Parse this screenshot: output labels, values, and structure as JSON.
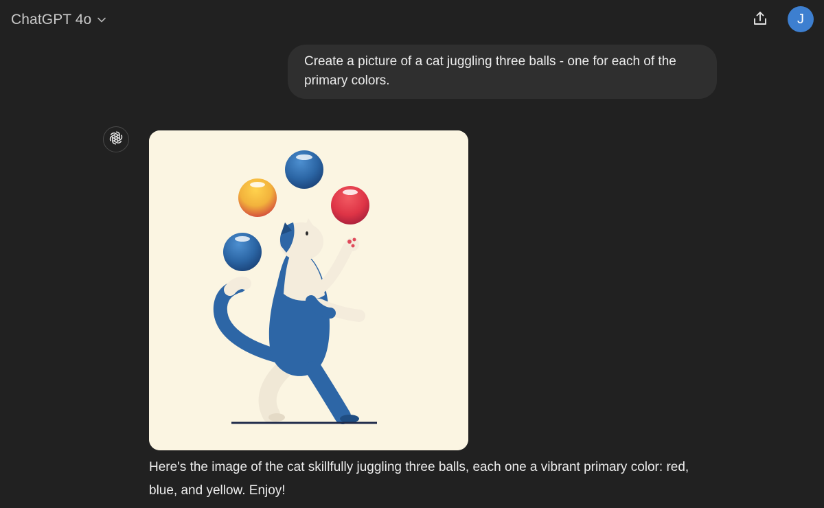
{
  "header": {
    "model_name": "ChatGPT 4o",
    "chevron_icon": "chevron-down-icon",
    "share_icon": "share-upload-icon",
    "avatar_initial": "J",
    "avatar_color": "#3d7fd0"
  },
  "conversation": {
    "user_message": "Create a picture of a cat juggling three balls - one for each of the primary colors.",
    "assistant_icon": "openai-logo-icon",
    "assistant_image": {
      "subject": "cat-juggling-illustration",
      "ball_colors": [
        "#2f6aa8",
        "#f0b43a",
        "#e03a48",
        "#2f6aa8"
      ],
      "background_color": "#fbf5e2"
    },
    "assistant_message": "Here's the image of the cat skillfully juggling three balls, each one a vibrant primary color: red, blue, and yellow. Enjoy!"
  },
  "theme": {
    "background": "#212121",
    "bubble": "#2f2f2f",
    "text": "#ececec"
  }
}
